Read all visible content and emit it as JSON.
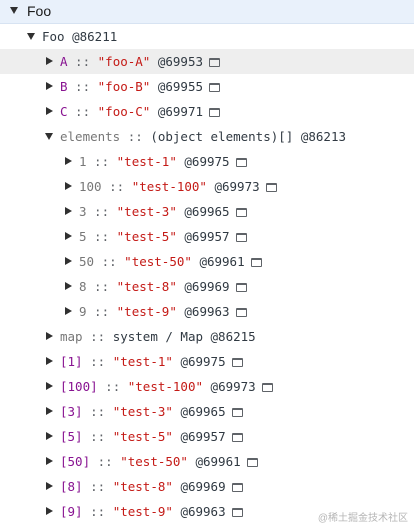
{
  "header": {
    "title": "Foo"
  },
  "tree": {
    "root_label": "Foo @86211",
    "rows": [
      {
        "key": "A",
        "key_style": "purple",
        "sep": " :: ",
        "value": "\"foo-A\"",
        "id": "@69953",
        "icon": "store-as-global-icon",
        "expanded": false,
        "highlighted": true
      },
      {
        "key": "B",
        "key_style": "purple",
        "sep": " :: ",
        "value": "\"foo-B\"",
        "id": "@69955",
        "icon": "store-as-global-icon",
        "expanded": false
      },
      {
        "key": "C",
        "key_style": "purple",
        "sep": " :: ",
        "value": "\"foo-C\"",
        "id": "@69971",
        "icon": "store-as-global-icon",
        "expanded": false
      },
      {
        "key": "elements",
        "key_style": "gray",
        "sep": " :: ",
        "value": "(object elements)[]",
        "id": "@86213",
        "expanded": true,
        "children": [
          {
            "key": "1",
            "sep": " :: ",
            "value": "\"test-1\"",
            "id": "@69975"
          },
          {
            "key": "100",
            "sep": " :: ",
            "value": "\"test-100\"",
            "id": "@69973"
          },
          {
            "key": "3",
            "sep": " :: ",
            "value": "\"test-3\"",
            "id": "@69965"
          },
          {
            "key": "5",
            "sep": " :: ",
            "value": "\"test-5\"",
            "id": "@69957"
          },
          {
            "key": "50",
            "sep": " :: ",
            "value": "\"test-50\"",
            "id": "@69961"
          },
          {
            "key": "8",
            "sep": " :: ",
            "value": "\"test-8\"",
            "id": "@69969"
          },
          {
            "key": "9",
            "sep": " :: ",
            "value": "\"test-9\"",
            "id": "@69963"
          }
        ]
      },
      {
        "key": "map",
        "key_style": "gray",
        "sep": " :: ",
        "value": "system / Map",
        "id": "@86215",
        "expanded": false
      },
      {
        "key": "[1]",
        "key_style": "purple",
        "sep": " :: ",
        "value": "\"test-1\"",
        "id": "@69975",
        "expanded": false
      },
      {
        "key": "[100]",
        "key_style": "purple",
        "sep": " :: ",
        "value": "\"test-100\"",
        "id": "@69973",
        "expanded": false
      },
      {
        "key": "[3]",
        "key_style": "purple",
        "sep": " :: ",
        "value": "\"test-3\"",
        "id": "@69965",
        "expanded": false
      },
      {
        "key": "[5]",
        "key_style": "purple",
        "sep": " :: ",
        "value": "\"test-5\"",
        "id": "@69957",
        "expanded": false
      },
      {
        "key": "[50]",
        "key_style": "purple",
        "sep": " :: ",
        "value": "\"test-50\"",
        "id": "@69961",
        "expanded": false
      },
      {
        "key": "[8]",
        "key_style": "purple",
        "sep": " :: ",
        "value": "\"test-8\"",
        "id": "@69969",
        "expanded": false
      },
      {
        "key": "[9]",
        "key_style": "purple",
        "sep": " :: ",
        "value": "\"test-9\"",
        "id": "@69963",
        "expanded": false
      }
    ]
  },
  "watermark": "@稀土掘金技术社区",
  "colors": {
    "key_purple": "#881391",
    "key_gray": "#777777",
    "string_red": "#c41a16",
    "header_bg": "#e9f1fb",
    "highlight_bg": "#eeeeee"
  }
}
